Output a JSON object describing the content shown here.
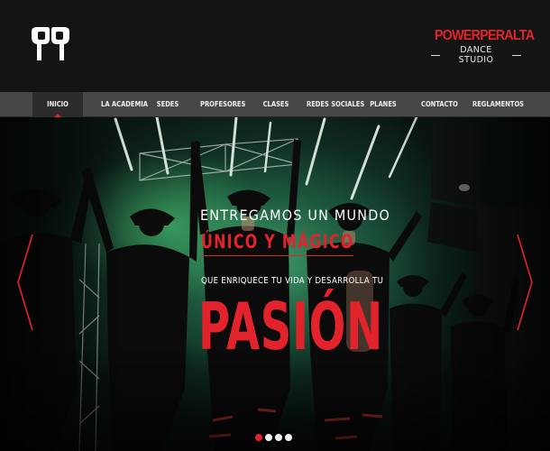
{
  "header": {
    "logo_icon": "pp-monogram-icon",
    "brand_name": "POWERPERALTA",
    "brand_sub": "DANCE STUDIO",
    "accent": "#e3232c"
  },
  "nav": {
    "items": [
      {
        "label": "INICIO",
        "active": true
      },
      {
        "label": "LA ACADEMIA"
      },
      {
        "label": "SEDES"
      },
      {
        "label": "PROFESORES"
      },
      {
        "label": "CLASES"
      },
      {
        "label": "REDES SOCIALES"
      },
      {
        "label": "PLANES"
      },
      {
        "label": "CONTACTO"
      },
      {
        "label": "REGLAMENTOS"
      }
    ]
  },
  "hero": {
    "line1": "ENTREGAMOS UN MUNDO",
    "line2": "ÚNICO Y MÁGICO",
    "line3": "QUE ENRIQUECE TU VIDA Y DESARROLLA TU",
    "line4": "PASIÓN",
    "prev_icon": "chevron-left-icon",
    "next_icon": "chevron-right-icon",
    "slides": 4,
    "active_slide": 1
  }
}
